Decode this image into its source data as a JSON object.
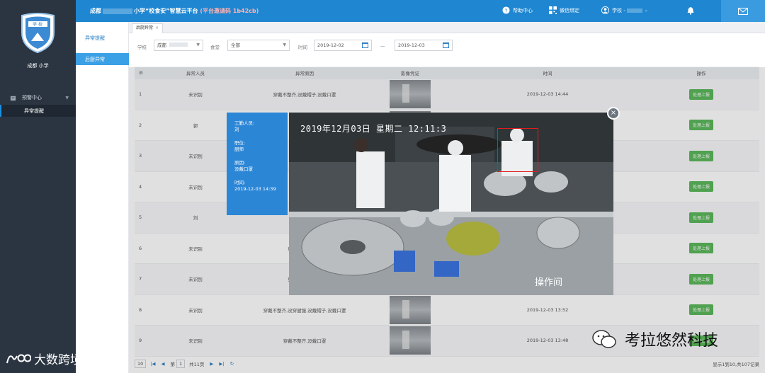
{
  "sidebar": {
    "logo_text": "学 校",
    "school_name": "成都        小学",
    "nav_group": "预警中心",
    "nav_sub_item": "异常提醒"
  },
  "header": {
    "title_prefix": "成都",
    "title_suffix": "小学“校食安”智慧云平台",
    "platform_code": "(平台邀请码 1b42cb)",
    "help": "帮助中心",
    "wechat": "微信绑定",
    "user": "学校 - "
  },
  "submenu": {
    "item1": "异常提醒",
    "item2": "后厨异常"
  },
  "tabs": [
    {
      "label": "后厨异常",
      "close": "×"
    }
  ],
  "filters": {
    "school_label": "学校",
    "school_value": "成都",
    "canteen_label": "食堂",
    "canteen_value": "全部",
    "time_label": "时间",
    "date_from": "2019-12-02",
    "dash": "—",
    "date_to": "2019-12-03"
  },
  "table": {
    "headers": [
      "",
      "异常人员",
      "异常原因",
      "影像凭证",
      "时间",
      "操作"
    ],
    "rows": [
      {
        "idx": "1",
        "person": "未识别",
        "reason": "穿戴不整齐,没戴帽子,没戴口罩",
        "time": "2019-12-03 14:44",
        "op": "处理上报"
      },
      {
        "idx": "2",
        "person": "郭",
        "reason": "",
        "time": "",
        "op": "处理上报"
      },
      {
        "idx": "3",
        "person": "未识别",
        "reason": "",
        "time": "",
        "op": "处理上报"
      },
      {
        "idx": "4",
        "person": "未识别",
        "reason": "",
        "time": "",
        "op": "处理上报"
      },
      {
        "idx": "5",
        "person": "刘",
        "reason": "穿戴不整齐,",
        "time": "",
        "op": "处理上报"
      },
      {
        "idx": "6",
        "person": "未识别",
        "reason": "穿戴不整齐,没穿",
        "time": "",
        "op": "处理上报"
      },
      {
        "idx": "7",
        "person": "未识别",
        "reason": "穿戴不整齐,没穿",
        "time": "",
        "op": "处理上报"
      },
      {
        "idx": "8",
        "person": "未识别",
        "reason": "穿戴不整齐,没穿厨服,没戴帽子,没戴口罩",
        "time": "2019-12-03 13:52",
        "op": "处理上报"
      },
      {
        "idx": "9",
        "person": "未识别",
        "reason": "穿戴不整齐,没戴口罩",
        "time": "2019-12-03 13:48",
        "op": "处理上报"
      }
    ]
  },
  "pager": {
    "page_size": "10",
    "page_label": "第",
    "page_value": "1",
    "total_pages": "共11页",
    "info": "显示1到10,共107记录"
  },
  "modal": {
    "worker_label": "工勤人员:",
    "worker_name": "刘",
    "post_label": "职位:",
    "post_value": "厨师",
    "reason_label": "原因:",
    "reason_value": "没戴口罩",
    "time_label": "时间:",
    "time_value": "2019-12-03 14:39",
    "photo_timestamp": "2019年12月03日  星期二  12:11:3",
    "photo_location": "操作间",
    "close": "×"
  },
  "watermarks": {
    "left": "大数跨境",
    "right": "考拉悠然科技"
  },
  "colors": {
    "header_blue": "#1f86d1",
    "sidebar_dark": "#2b3541",
    "report_green": "#5cb85c",
    "card_blue": "#2c86d6"
  }
}
